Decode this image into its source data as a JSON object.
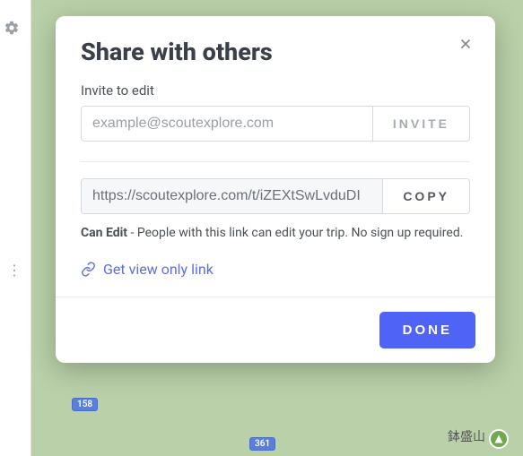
{
  "modal": {
    "title": "Share with others",
    "invite_label": "Invite to edit",
    "email_placeholder": "example@scoutexplore.com",
    "invite_button": "INVITE",
    "share_url": "https://scoutexplore.com/t/iZEXtSwLvduDI",
    "copy_button": "COPY",
    "permission_bold": "Can Edit",
    "permission_rest": " - People with this link can edit your trip. No sign up required.",
    "view_only_link": "Get view only link",
    "done_button": "DONE"
  },
  "map": {
    "road_labels": [
      "158",
      "361"
    ],
    "peak_label": "鉢盛山"
  }
}
